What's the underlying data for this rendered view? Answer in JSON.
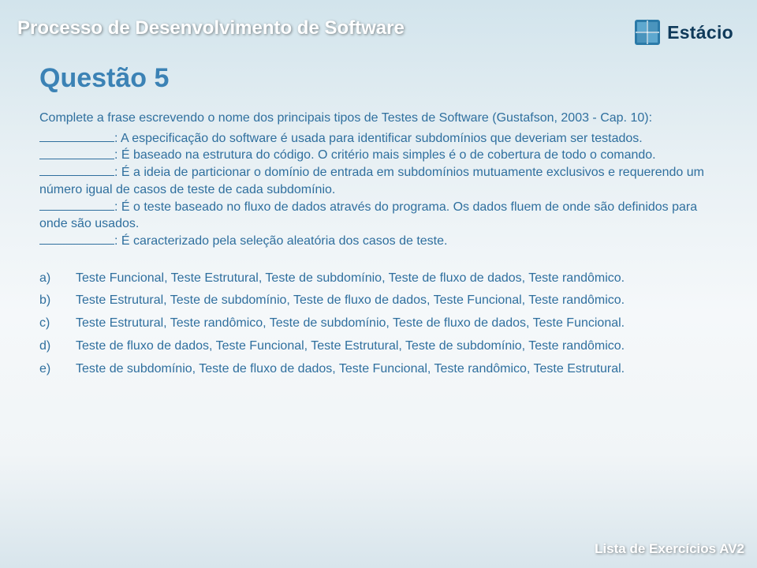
{
  "header": {
    "title": "Processo de Desenvolvimento de Software",
    "brand": "Estácio"
  },
  "question": {
    "title": "Questão 5",
    "intro": "Complete a frase escrevendo o nome dos principais tipos de Testes de Software (Gustafson, 2003 - Cap. 10):",
    "fills": [
      ": A especificação do software é usada para identificar subdomínios que deveriam ser testados.",
      ": É baseado na estrutura do código. O critério mais simples é o de cobertura de todo o comando.",
      ": É a ideia de particionar o domínio de entrada em subdomínios mutuamente exclusivos e requerendo um número igual de casos de teste de cada subdomínio.",
      ": É o teste baseado no fluxo de dados através do programa. Os dados fluem de onde são definidos para onde são usados.",
      ": É caracterizado pela seleção aleatória dos casos de teste."
    ],
    "options": [
      {
        "label": "a)",
        "text": "Teste Funcional, Teste Estrutural, Teste de subdomínio, Teste de fluxo de dados, Teste randômico."
      },
      {
        "label": "b)",
        "text": "Teste Estrutural, Teste de subdomínio, Teste de fluxo de dados, Teste Funcional, Teste randômico."
      },
      {
        "label": "c)",
        "text": "Teste Estrutural, Teste randômico, Teste de subdomínio, Teste de fluxo de dados, Teste Funcional."
      },
      {
        "label": "d)",
        "text": "Teste de fluxo de dados, Teste Funcional, Teste Estrutural, Teste de subdomínio, Teste randômico."
      },
      {
        "label": "e)",
        "text": "Teste de subdomínio, Teste de fluxo de dados, Teste Funcional, Teste randômico, Teste Estrutural."
      }
    ]
  },
  "footer": "Lista de Exercícios AV2"
}
